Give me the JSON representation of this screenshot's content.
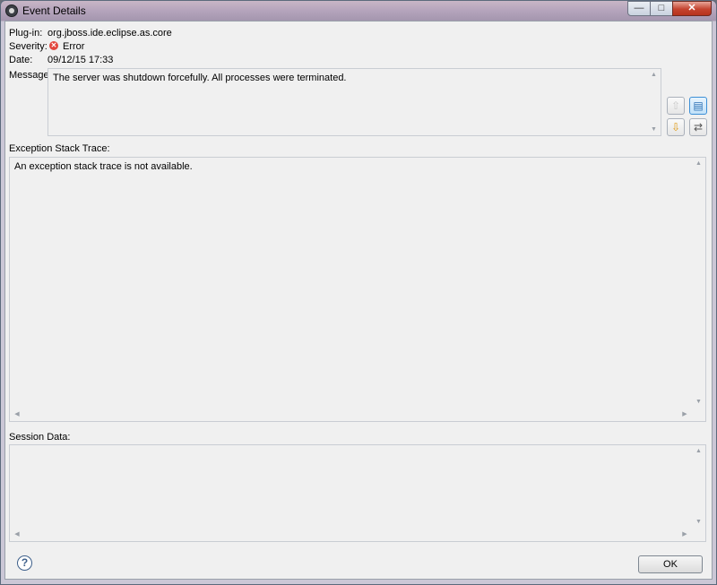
{
  "window": {
    "title": "Event Details",
    "minimize": "—",
    "maximize": "□",
    "close": "✕"
  },
  "fields": {
    "plugin_label": "Plug-in:",
    "plugin_value": "org.jboss.ide.eclipse.as.core",
    "severity_label": "Severity:",
    "severity_value": "Error",
    "date_label": "Date:",
    "date_value": "09/12/15 17:33",
    "message_label": "Message:",
    "message_value": "The server was shutdown forcefully. All processes were terminated."
  },
  "exception": {
    "label": "Exception Stack Trace:",
    "text": "An exception stack trace is not available."
  },
  "session": {
    "label": "Session Data:"
  },
  "buttons": {
    "ok": "OK",
    "help": "?"
  },
  "icons": {
    "previous": "arrow-up-icon",
    "next": "arrow-down-icon",
    "copy": "copy-icon",
    "filter": "filter-icon",
    "error": "error-icon"
  },
  "colors": {
    "error": "#e2453c",
    "active_button": "#3c8fd6"
  }
}
